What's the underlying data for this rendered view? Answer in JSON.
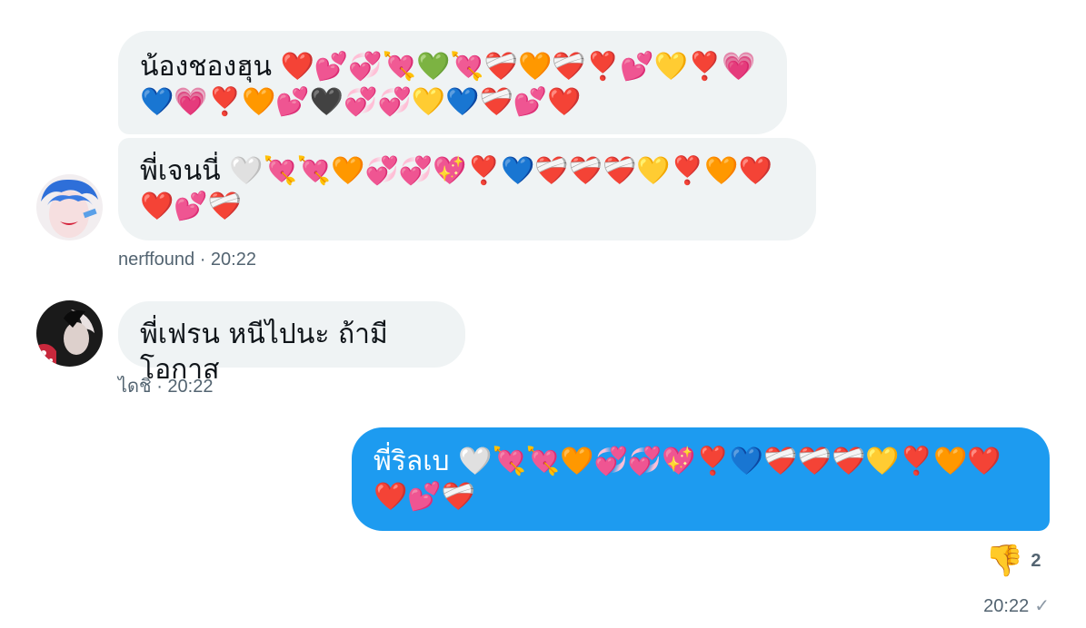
{
  "messages": [
    {
      "text": "น้องชองฮุน ❤️💕💞💘💚💘❤️‍🩹🧡❤️‍🩹❣️💕💛❣️💗💙💗❣️🧡💕🖤💞💞💛💙❤️‍🩹💕❤️"
    },
    {
      "text": "พี่เจนนี่ 🤍💘💘🧡💞💞💖❣️💙❤️‍🩹❤️‍🩹❤️‍🩹💛❣️🧡❤️❤️💕❤️‍🩹",
      "sender": "nerffound",
      "time": "· 20:22"
    },
    {
      "text": "พี่เฟรน หนีไปนะ ถ้ามีโอกาส",
      "sender": "ไดชิ",
      "time": "· 20:22"
    },
    {
      "text": "พี่ริลเบ 🤍💘💘🧡💞💞💖❣️💙❤️‍🩹❤️‍🩹❤️‍🩹💛❣️🧡❤️❤️💕❤️‍🩹",
      "time": "20:22",
      "reaction": {
        "emoji": "👎",
        "count": "2"
      },
      "status": "✓"
    }
  ],
  "colors": {
    "incoming_bubble": "#eff3f4",
    "outgoing_bubble": "#1d9bf0",
    "meta_text": "#536471"
  }
}
